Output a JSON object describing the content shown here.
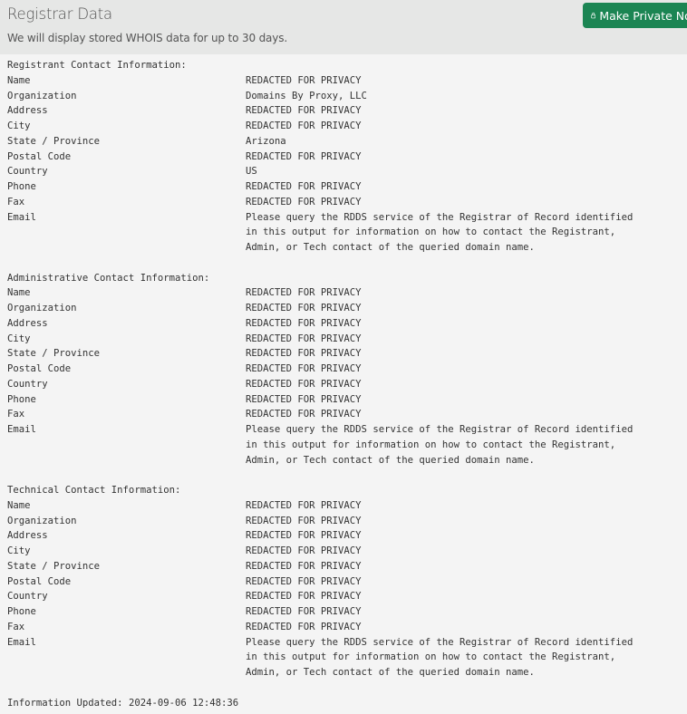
{
  "header": {
    "title": "Registrar Data",
    "subtitle": "We will display stored WHOIS data for up to 30 days.",
    "button_label": "Make Private Now",
    "button_icon": "lock-icon",
    "button_color": "#1b8553"
  },
  "sections": [
    {
      "heading": "Registrant Contact Information:",
      "rows": [
        {
          "label": "Name",
          "value": "REDACTED FOR PRIVACY"
        },
        {
          "label": "Organization",
          "value": "Domains By Proxy, LLC"
        },
        {
          "label": "Address",
          "value": "REDACTED FOR PRIVACY"
        },
        {
          "label": "City",
          "value": "REDACTED FOR PRIVACY"
        },
        {
          "label": "State / Province",
          "value": "Arizona"
        },
        {
          "label": "Postal Code",
          "value": "REDACTED FOR PRIVACY"
        },
        {
          "label": "Country",
          "value": "US"
        },
        {
          "label": "Phone",
          "value": "REDACTED FOR PRIVACY"
        },
        {
          "label": "Fax",
          "value": "REDACTED FOR PRIVACY"
        },
        {
          "label": "Email",
          "value": [
            "Please query the RDDS service of the Registrar of Record identified",
            "in this output for information on how to contact the Registrant,",
            "Admin, or Tech contact of the queried domain name."
          ]
        }
      ]
    },
    {
      "heading": "Administrative Contact Information:",
      "rows": [
        {
          "label": "Name",
          "value": "REDACTED FOR PRIVACY"
        },
        {
          "label": "Organization",
          "value": "REDACTED FOR PRIVACY"
        },
        {
          "label": "Address",
          "value": "REDACTED FOR PRIVACY"
        },
        {
          "label": "City",
          "value": "REDACTED FOR PRIVACY"
        },
        {
          "label": "State / Province",
          "value": "REDACTED FOR PRIVACY"
        },
        {
          "label": "Postal Code",
          "value": "REDACTED FOR PRIVACY"
        },
        {
          "label": "Country",
          "value": "REDACTED FOR PRIVACY"
        },
        {
          "label": "Phone",
          "value": "REDACTED FOR PRIVACY"
        },
        {
          "label": "Fax",
          "value": "REDACTED FOR PRIVACY"
        },
        {
          "label": "Email",
          "value": [
            "Please query the RDDS service of the Registrar of Record identified",
            "in this output for information on how to contact the Registrant,",
            "Admin, or Tech contact of the queried domain name."
          ]
        }
      ]
    },
    {
      "heading": "Technical Contact Information:",
      "rows": [
        {
          "label": "Name",
          "value": "REDACTED FOR PRIVACY"
        },
        {
          "label": "Organization",
          "value": "REDACTED FOR PRIVACY"
        },
        {
          "label": "Address",
          "value": "REDACTED FOR PRIVACY"
        },
        {
          "label": "City",
          "value": "REDACTED FOR PRIVACY"
        },
        {
          "label": "State / Province",
          "value": "REDACTED FOR PRIVACY"
        },
        {
          "label": "Postal Code",
          "value": "REDACTED FOR PRIVACY"
        },
        {
          "label": "Country",
          "value": "REDACTED FOR PRIVACY"
        },
        {
          "label": "Phone",
          "value": "REDACTED FOR PRIVACY"
        },
        {
          "label": "Fax",
          "value": "REDACTED FOR PRIVACY"
        },
        {
          "label": "Email",
          "value": [
            "Please query the RDDS service of the Registrar of Record identified",
            "in this output for information on how to contact the Registrant,",
            "Admin, or Tech contact of the queried domain name."
          ]
        }
      ]
    }
  ],
  "footer": {
    "updated_label": "Information Updated:",
    "updated_value": "2024-09-06 12:48:36"
  }
}
